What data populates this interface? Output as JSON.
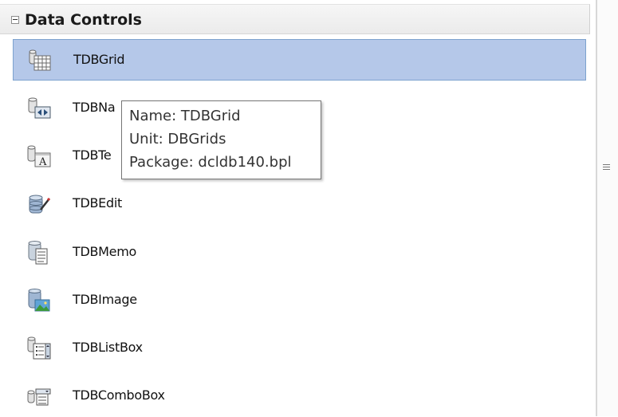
{
  "category": {
    "title": "Data Controls",
    "collapse_icon": "collapse-minus-icon"
  },
  "items": [
    {
      "label": "TDBGrid",
      "icon": "dbgrid-icon",
      "selected": true
    },
    {
      "label": "TDBNa",
      "icon": "dbnavigator-icon",
      "selected": false
    },
    {
      "label": "TDBTe",
      "icon": "dbtext-icon",
      "selected": false
    },
    {
      "label": "TDBEdit",
      "icon": "dbedit-icon",
      "selected": false
    },
    {
      "label": "TDBMemo",
      "icon": "dbmemo-icon",
      "selected": false
    },
    {
      "label": "TDBImage",
      "icon": "dbimage-icon",
      "selected": false
    },
    {
      "label": "TDBListBox",
      "icon": "dblistbox-icon",
      "selected": false
    },
    {
      "label": "TDBComboBox",
      "icon": "dbcombobox-icon",
      "selected": false
    }
  ],
  "tooltip": {
    "name_line": "Name: TDBGrid",
    "unit_line": "Unit: DBGrids",
    "package_line": "Package: dcldb140.bpl"
  },
  "colors": {
    "selection_fill": "#b5c8e9",
    "selection_border": "#7da2ce",
    "header_fill": "#efefef"
  }
}
